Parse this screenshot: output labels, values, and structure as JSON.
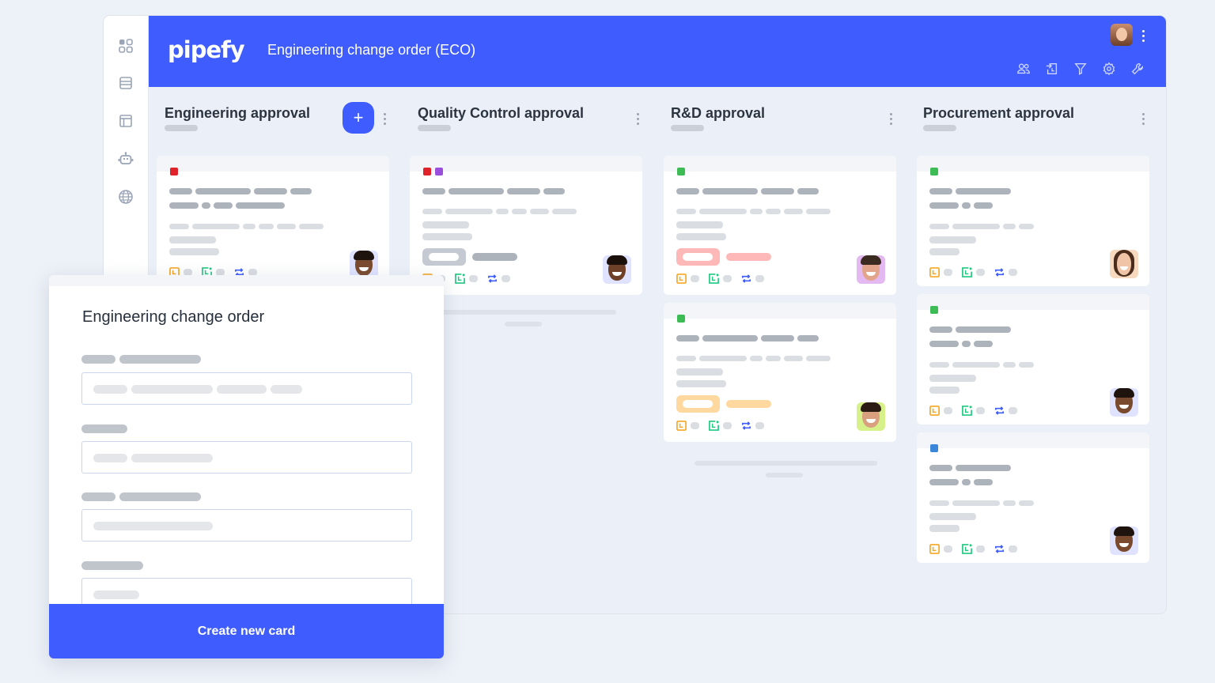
{
  "app": {
    "logo": "pipefy",
    "pipe_title": "Engineering change order (ECO)"
  },
  "sidebar": {
    "items": [
      {
        "icon": "grid-icon",
        "label": "Pipes"
      },
      {
        "icon": "database-icon",
        "label": "Databases"
      },
      {
        "icon": "layout-icon",
        "label": "Interfaces"
      },
      {
        "icon": "robot-icon",
        "label": "Automations"
      },
      {
        "icon": "globe-icon",
        "label": "Portals"
      }
    ]
  },
  "header_tools": [
    "members-icon",
    "import-icon",
    "filter-icon",
    "settings-icon",
    "wrench-icon"
  ],
  "phases": [
    {
      "title": "Engineering approval",
      "has_add_button": true,
      "add_label": "+"
    },
    {
      "title": "Quality Control approval",
      "has_add_button": false
    },
    {
      "title": "R&D approval",
      "has_add_button": false
    },
    {
      "title": "Procurement approval",
      "has_add_button": false
    }
  ],
  "label_colors": {
    "red": "#e0232b",
    "purple": "#9a4fdc",
    "green": "#3dbb54",
    "blue": "#3a86d8"
  },
  "status_tags": {
    "gray": "#c5cad2",
    "red": "#ffb8b8",
    "orange": "#ffd8a0"
  },
  "modal": {
    "title": "Engineering change order",
    "submit_label": "Create new card"
  }
}
